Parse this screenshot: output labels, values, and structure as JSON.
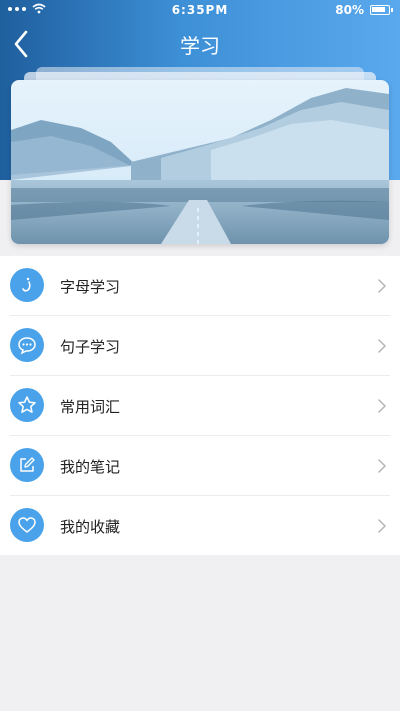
{
  "status_bar": {
    "time": "6:35PM",
    "battery": "80%",
    "icons": [
      "signal-dots-icon",
      "wifi-icon",
      "battery-icon"
    ]
  },
  "nav": {
    "title": "学习",
    "back_icon": "chevron-left-icon"
  },
  "banner": {
    "image": "mountain-road-landscape"
  },
  "menu": {
    "items": [
      {
        "label": "字母学习",
        "icon": "letter-icon"
      },
      {
        "label": "句子学习",
        "icon": "chat-bubble-icon"
      },
      {
        "label": "常用词汇",
        "icon": "star-icon"
      },
      {
        "label": "我的笔记",
        "icon": "edit-note-icon"
      },
      {
        "label": "我的收藏",
        "icon": "heart-icon"
      }
    ]
  },
  "colors": {
    "header_start": "#1f5f9e",
    "header_end": "#5aa9ee",
    "icon_bg": "#4aa3ea",
    "page_bg": "#f0f0f2"
  }
}
